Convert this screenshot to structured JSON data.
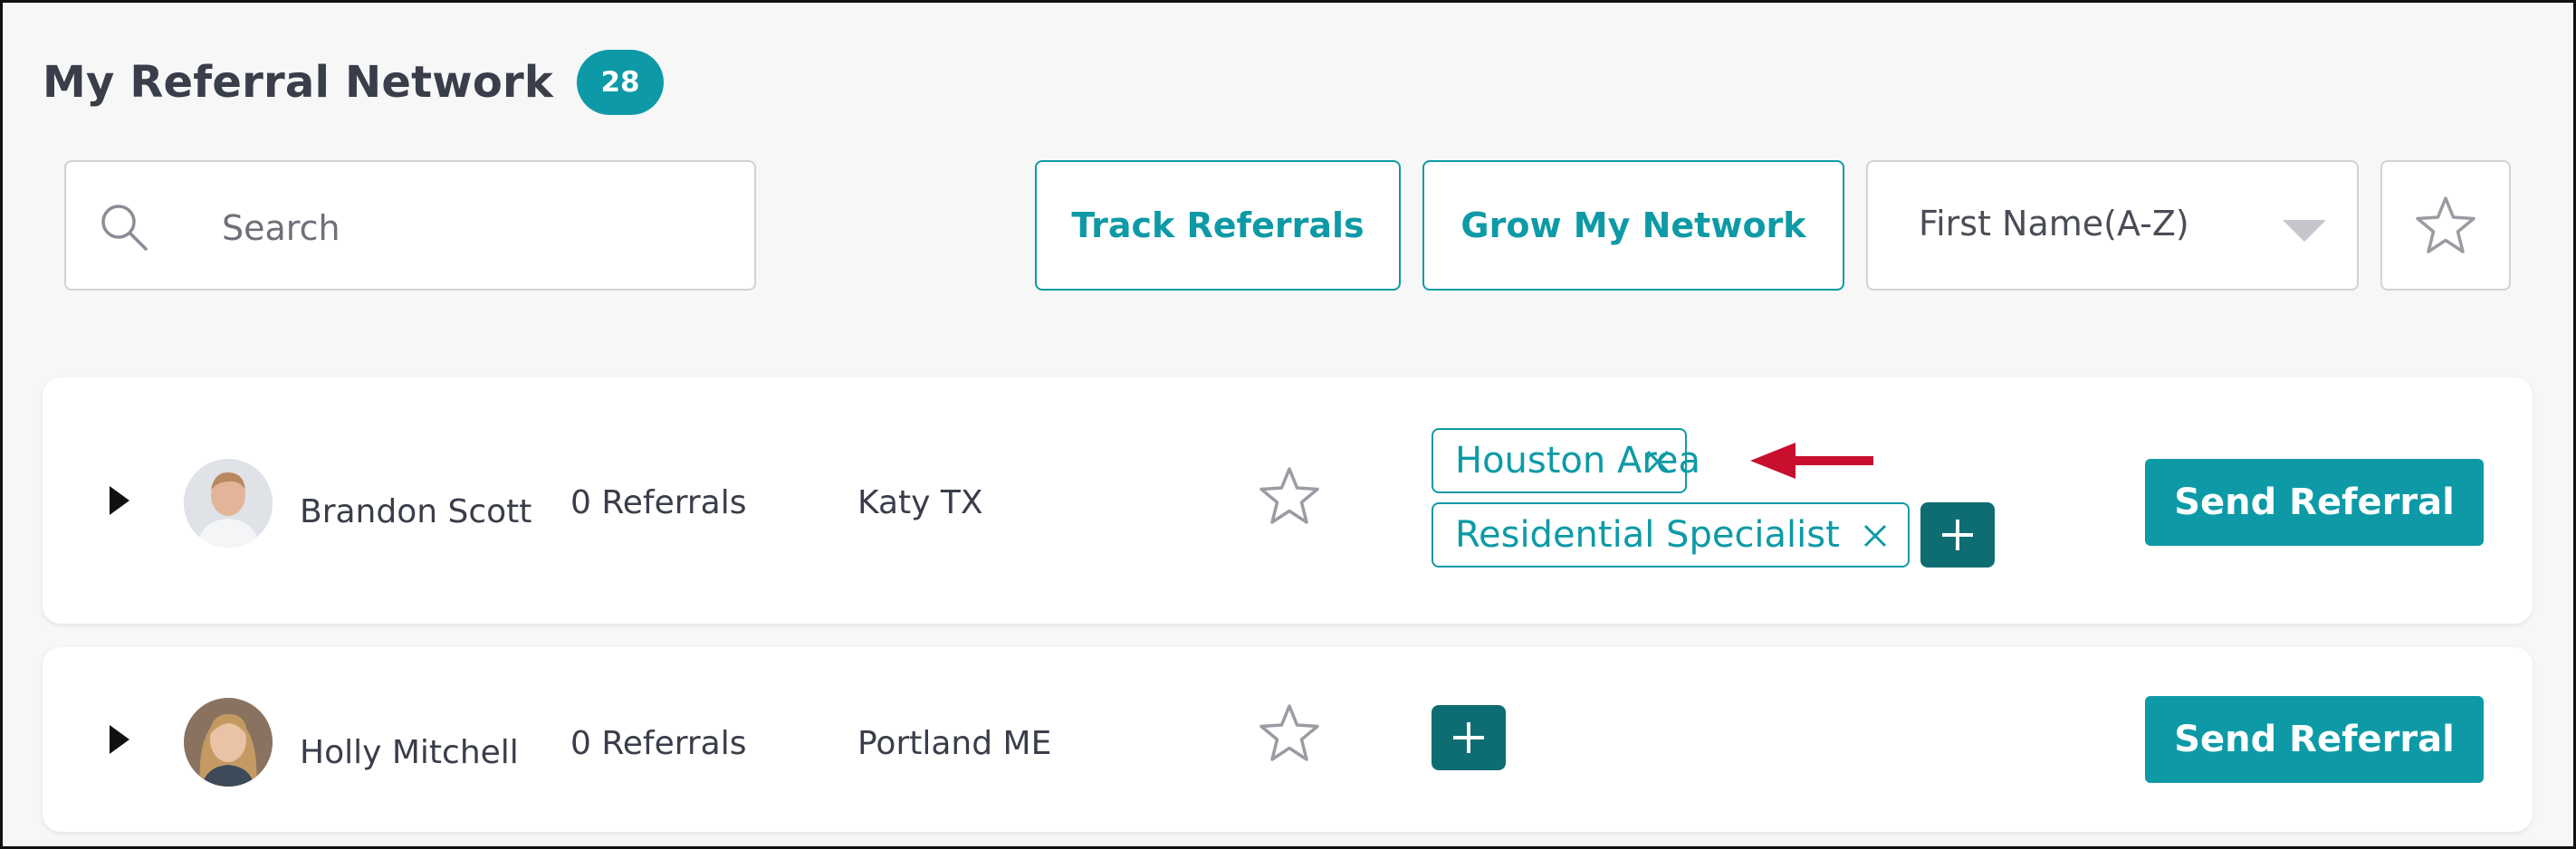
{
  "header": {
    "title": "My Referral Network",
    "count": "28"
  },
  "toolbar": {
    "search_placeholder": "Search",
    "track_referrals": "Track Referrals",
    "grow_network": "Grow My Network",
    "sort_selected": "First Name(A-Z)"
  },
  "contacts": [
    {
      "name": "Brandon Scott",
      "referrals": "0 Referrals",
      "location": "Katy TX",
      "tags": [
        "Houston Area",
        "Residential Specialist"
      ],
      "send_label": "Send Referral"
    },
    {
      "name": "Holly Mitchell",
      "referrals": "0 Referrals",
      "location": "Portland ME",
      "tags": [],
      "send_label": "Send Referral"
    }
  ],
  "colors": {
    "accent": "#0d9aa6",
    "add_tag": "#0e6d72",
    "annotation_arrow": "#c8102e"
  },
  "icons": [
    "search-icon",
    "star-icon",
    "chevron-down-icon",
    "caret-right-icon",
    "close-icon",
    "plus-icon",
    "arrow-left-icon"
  ]
}
